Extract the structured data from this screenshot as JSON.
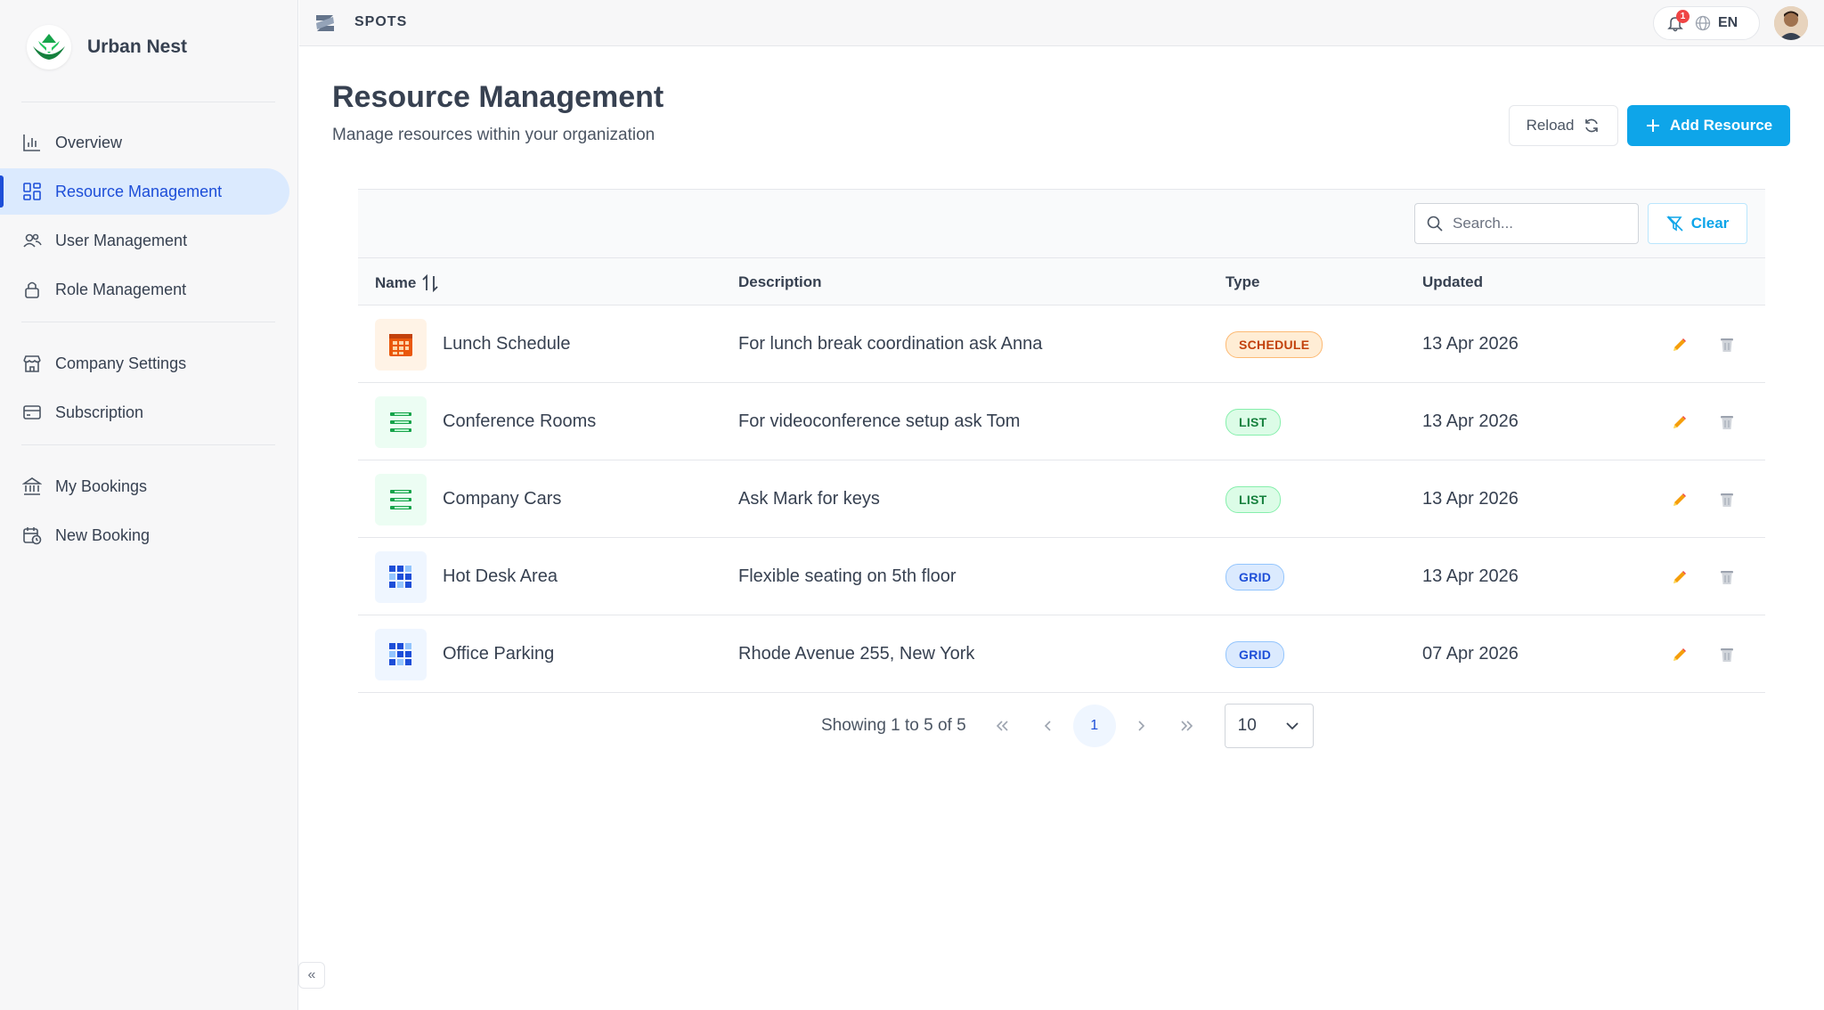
{
  "sidebar": {
    "brand": "Urban Nest",
    "items": [
      {
        "label": "Overview",
        "icon": "bar-chart-icon"
      },
      {
        "label": "Resource Management",
        "icon": "grid-icon",
        "active": true
      },
      {
        "label": "User Management",
        "icon": "users-icon"
      },
      {
        "label": "Role Management",
        "icon": "lock-icon"
      },
      {
        "label": "Company Settings",
        "icon": "store-icon"
      },
      {
        "label": "Subscription",
        "icon": "credit-card-icon"
      },
      {
        "label": "My Bookings",
        "icon": "bank-icon"
      },
      {
        "label": "New Booking",
        "icon": "calendar-clock-icon"
      }
    ],
    "collapse_label": "«"
  },
  "topbar": {
    "app_name": "SPOTS",
    "notification_count": "1",
    "language": "EN"
  },
  "page": {
    "title": "Resource Management",
    "subtitle": "Manage resources within your organization",
    "reload_label": "Reload",
    "add_label": "Add Resource"
  },
  "toolbar": {
    "search_placeholder": "Search...",
    "search_value": "",
    "clear_label": "Clear"
  },
  "table": {
    "columns": {
      "name": "Name",
      "description": "Description",
      "type": "Type",
      "updated": "Updated"
    },
    "rows": [
      {
        "name": "Lunch Schedule",
        "description": "For lunch break coordination ask Anna",
        "type": "SCHEDULE",
        "updated": "13 Apr 2026",
        "icon": "schedule-icon"
      },
      {
        "name": "Conference Rooms",
        "description": "For videoconference setup ask Tom",
        "type": "LIST",
        "updated": "13 Apr 2026",
        "icon": "list-icon"
      },
      {
        "name": "Company Cars",
        "description": "Ask Mark for keys",
        "type": "LIST",
        "updated": "13 Apr 2026",
        "icon": "list-icon"
      },
      {
        "name": "Hot Desk Area",
        "description": "Flexible seating on 5th floor",
        "type": "GRID",
        "updated": "13 Apr 2026",
        "icon": "grid-layout-icon"
      },
      {
        "name": "Office Parking",
        "description": "Rhode Avenue 255, New York",
        "type": "GRID",
        "updated": "07 Apr 2026",
        "icon": "grid-layout-icon"
      }
    ]
  },
  "pagination": {
    "summary": "Showing 1 to 5 of 5",
    "current_page": "1",
    "page_size": "10"
  },
  "colors": {
    "accent": "#0ea5e9",
    "active_nav": "#1d4ed8",
    "schedule": "#c2410c",
    "list": "#15803d",
    "grid": "#1d4ed8"
  }
}
